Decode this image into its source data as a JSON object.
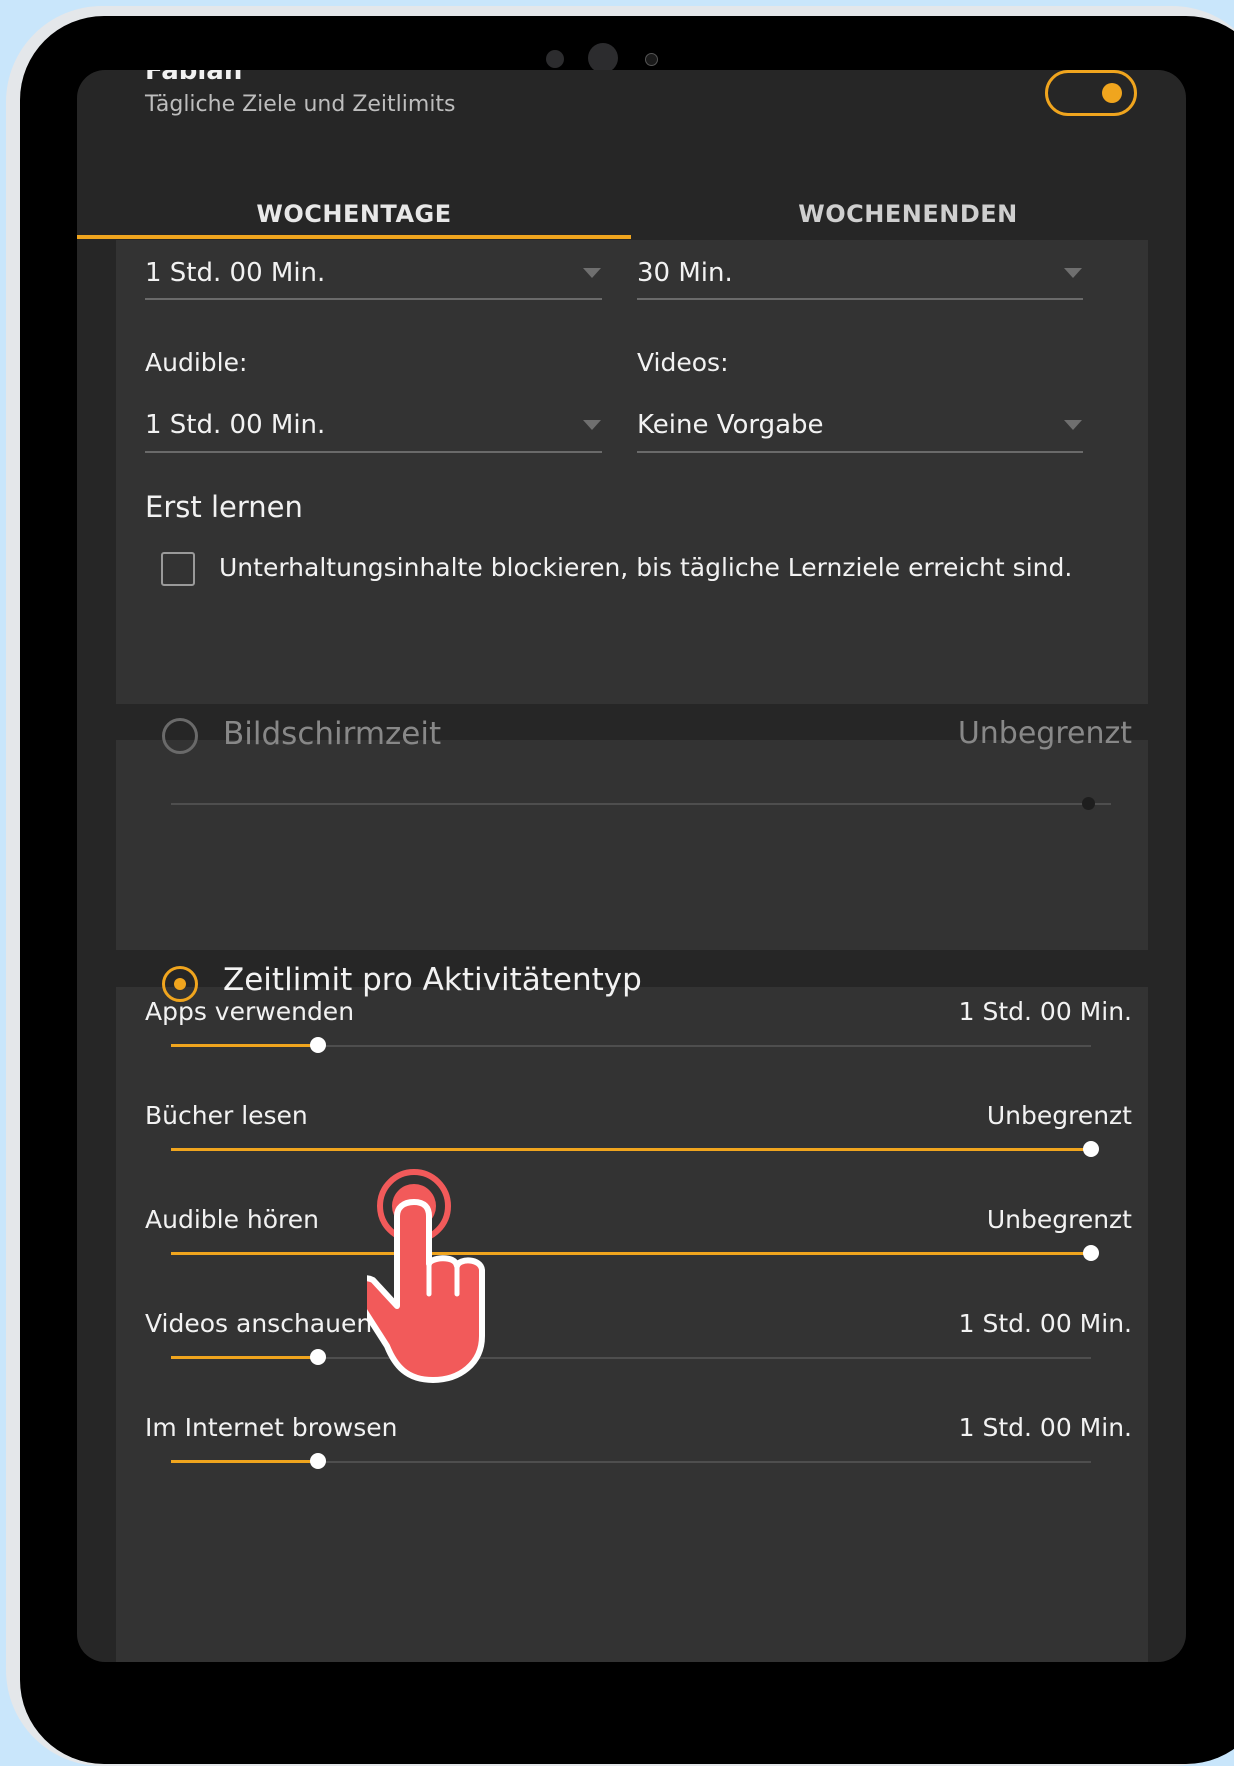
{
  "header": {
    "user_name": "Fabian",
    "subtitle": "Tägliche Ziele und Zeitlimits"
  },
  "tabs": [
    {
      "label": "WOCHENTAGE",
      "active": true
    },
    {
      "label": "WOCHENENDEN",
      "active": false
    }
  ],
  "goals": {
    "row1_left_value": "1 Std. 00 Min.",
    "row1_right_value": "30 Min.",
    "audible_label": "Audible:",
    "audible_value": "1 Std. 00 Min.",
    "videos_label": "Videos:",
    "videos_value": "Keine Vorgabe"
  },
  "learn_first": {
    "title": "Erst lernen",
    "checkbox_label": "Unterhaltungsinhalte blockieren, bis tägliche Lernziele erreicht sind.",
    "checked": false
  },
  "screen_time": {
    "title": "Bildschirmzeit",
    "value": "Unbegrenzt",
    "selected": false,
    "level": 1.0
  },
  "per_activity": {
    "title": "Zeitlimit pro Aktivitätentyp",
    "selected": true,
    "rows": [
      {
        "label": "Apps verwenden",
        "value": "1 Std. 00 Min.",
        "level": 0.16
      },
      {
        "label": "Bücher lesen",
        "value": "Unbegrenzt",
        "level": 1.0
      },
      {
        "label": "Audible hören",
        "value": "Unbegrenzt",
        "level": 1.0
      },
      {
        "label": "Videos anschauen",
        "value": "1 Std. 00 Min.",
        "level": 0.16
      },
      {
        "label": "Im Internet browsen",
        "value": "1 Std. 00 Min.",
        "level": 0.16
      }
    ]
  },
  "colors": {
    "accent": "#f0a51e",
    "background": "#262626",
    "card": "#333333",
    "pointer": "#f25a5a"
  },
  "pointer": {
    "icon": "tap-hand-icon"
  }
}
